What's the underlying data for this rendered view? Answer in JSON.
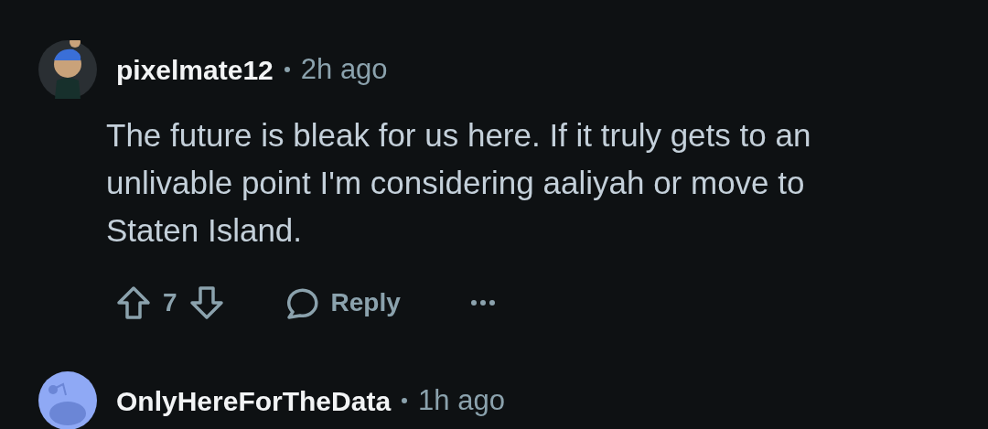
{
  "comments": [
    {
      "avatar": {
        "kind": "custom"
      },
      "username": "pixelmate12",
      "time": "2h ago",
      "body": "The future is bleak for us here. If it truly gets to an unlivable point I'm considering aaliyah or move to Staten Island.",
      "votes": "7",
      "reply": "Reply"
    },
    {
      "avatar": {
        "kind": "default"
      },
      "username": "OnlyHereForTheData",
      "time": "1h ago"
    }
  ]
}
